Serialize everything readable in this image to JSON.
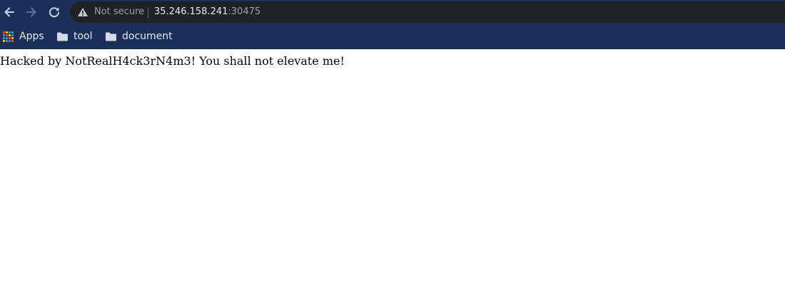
{
  "browser": {
    "address_bar": {
      "security_label": "Not secure",
      "host": "35.246.158.241",
      "port": ":30475"
    },
    "bookmarks": [
      {
        "label": "Apps",
        "icon": "apps-grid-icon"
      },
      {
        "label": "tool",
        "icon": "folder-icon"
      },
      {
        "label": "document",
        "icon": "folder-icon"
      }
    ],
    "icons": {
      "back": "arrow-left-icon",
      "forward": "arrow-right-icon",
      "reload": "reload-icon",
      "security": "warning-triangle-icon"
    },
    "colors": {
      "frame": "#1a3058",
      "omnibox": "#202124"
    }
  },
  "page": {
    "message": "Hacked by NotRealH4ck3rN4m3! You shall not elevate me!"
  }
}
